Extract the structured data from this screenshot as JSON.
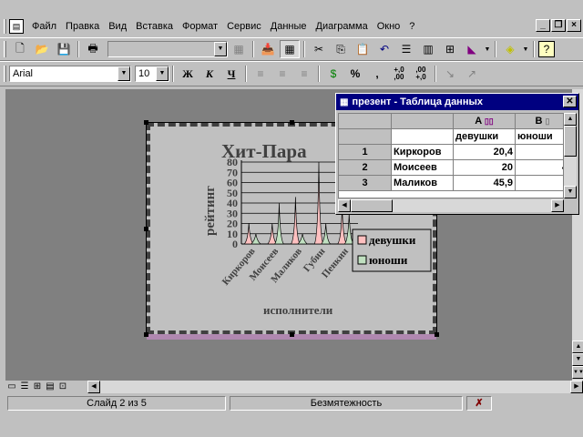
{
  "menu": {
    "items": [
      "Файл",
      "Правка",
      "Вид",
      "Вставка",
      "Формат",
      "Сервис",
      "Данные",
      "Диаграмма",
      "Окно",
      "?"
    ],
    "window_buttons": [
      "_",
      "❐",
      "×"
    ]
  },
  "format_toolbar": {
    "font": "Arial",
    "size": "10",
    "bold": "Ж",
    "italic": "К",
    "underline": "Ч",
    "percent": "%",
    "comma": ",",
    "inc_decimal": "+,0\n,00",
    "dec_decimal": ",00\n+,0"
  },
  "chart_data": {
    "type": "area",
    "title": "Хит-Пара",
    "xlabel": "исполнители",
    "ylabel": "рейтинг",
    "ylim": [
      0,
      80
    ],
    "yticks": [
      "0",
      "10",
      "20",
      "30",
      "40",
      "50",
      "60",
      "70",
      "80"
    ],
    "categories": [
      "Киркоров",
      "Моисеев",
      "Маликов",
      "Губин",
      "Пенкин"
    ],
    "series": [
      {
        "name": "девушки",
        "values": [
          20.4,
          20,
          45.9,
          80,
          37
        ],
        "color": "#ffc0c0"
      },
      {
        "name": "юноши",
        "values": [
          10,
          40,
          10,
          20,
          30
        ],
        "color": "#c0e0c0"
      }
    ],
    "legend_position": "right"
  },
  "datasheet": {
    "title": "презент - Таблица данных",
    "columns": [
      "A",
      "B"
    ],
    "headers": [
      "девушки",
      "юноши"
    ],
    "rows": [
      {
        "num": "1",
        "name": "Киркоров",
        "a": "20,4",
        "b": ""
      },
      {
        "num": "2",
        "name": "Моисеев",
        "a": "20",
        "b": "4"
      },
      {
        "num": "3",
        "name": "Маликов",
        "a": "45,9",
        "b": ""
      }
    ]
  },
  "status": {
    "slide": "Слайд 2 из 5",
    "design": "Безмятежность"
  }
}
